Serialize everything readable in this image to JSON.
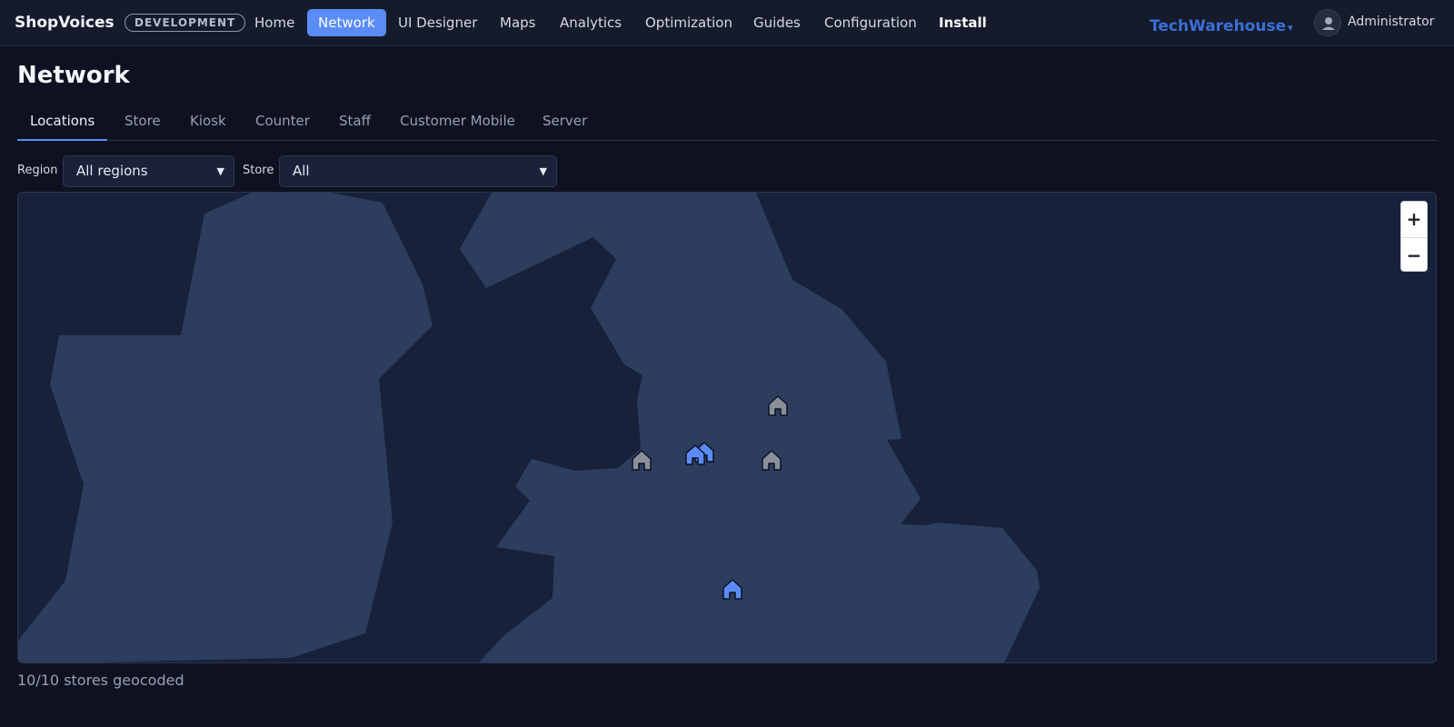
{
  "app": {
    "name": "ShopVoices",
    "environment": "DEVELOPMENT",
    "nav": [
      {
        "label": "Home"
      },
      {
        "label": "Network",
        "active": true
      },
      {
        "label": "UI Designer"
      },
      {
        "label": "Maps"
      },
      {
        "label": "Analytics"
      },
      {
        "label": "Optimization"
      },
      {
        "label": "Guides"
      },
      {
        "label": "Configuration"
      },
      {
        "label": "Install",
        "bold": true
      }
    ],
    "organization": "TechWarehouse",
    "org_caret": "▾",
    "user": "Administrator",
    "accent_color": "#5b8cf6"
  },
  "page": {
    "title": "Network",
    "tabs": [
      {
        "label": "Locations",
        "active": true
      },
      {
        "label": "Store"
      },
      {
        "label": "Kiosk"
      },
      {
        "label": "Counter"
      },
      {
        "label": "Staff"
      },
      {
        "label": "Customer Mobile"
      },
      {
        "label": "Server"
      }
    ]
  },
  "filters": {
    "region": {
      "label": "Region",
      "value": "All regions"
    },
    "store": {
      "label": "Store",
      "value": "All"
    }
  },
  "map": {
    "zoom_in": "+",
    "zoom_out": "−",
    "markers": [
      {
        "icon": "store-house-icon",
        "status": "inactive"
      },
      {
        "icon": "store-house-icon",
        "status": "inactive"
      },
      {
        "icon": "store-house-icon",
        "status": "active"
      },
      {
        "icon": "store-house-icon",
        "status": "active"
      },
      {
        "icon": "store-house-icon",
        "status": "inactive"
      },
      {
        "icon": "store-house-icon",
        "status": "active"
      }
    ],
    "marker_colors": {
      "active": "#5b8cf6",
      "inactive": "#8a8f99"
    }
  },
  "status": {
    "geocoded": "10/10 stores geocoded"
  }
}
